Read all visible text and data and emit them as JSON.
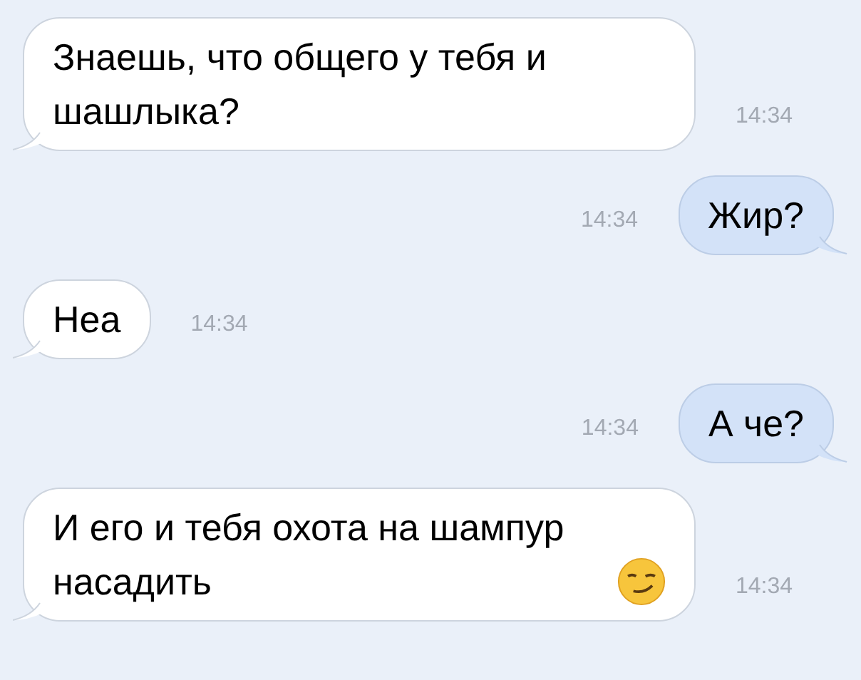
{
  "messages": [
    {
      "kind": "incoming",
      "text": "Знаешь, что общего у тебя и шашлыка?",
      "time": "14:34"
    },
    {
      "kind": "outgoing",
      "text": "Жир?",
      "time": "14:34"
    },
    {
      "kind": "incoming",
      "text": "Неа",
      "time": "14:34"
    },
    {
      "kind": "outgoing",
      "text": "А че?",
      "time": "14:34"
    },
    {
      "kind": "incoming",
      "text": "И его и тебя охота на шампур насадить",
      "time": "14:34",
      "emoji": true
    }
  ]
}
